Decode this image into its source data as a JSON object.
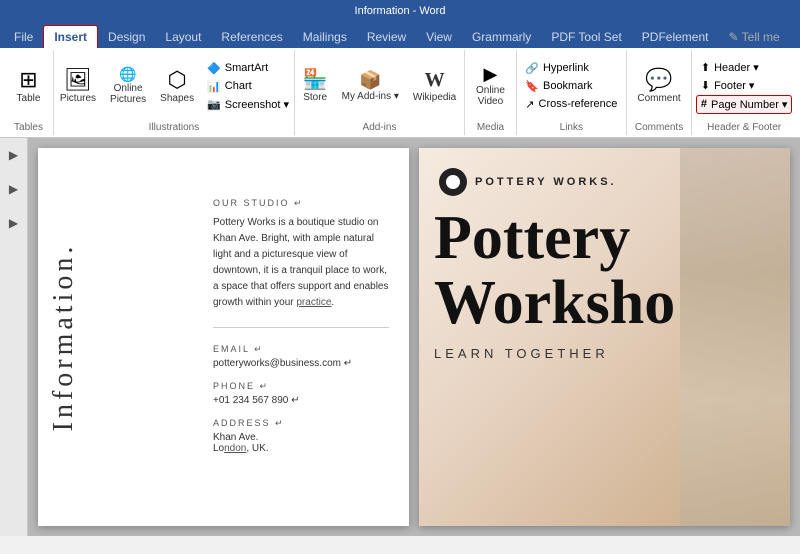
{
  "titlebar": {
    "text": "Information - Word"
  },
  "tabs": [
    {
      "label": "File",
      "active": false
    },
    {
      "label": "Insert",
      "active": true
    },
    {
      "label": "Design",
      "active": false
    },
    {
      "label": "Layout",
      "active": false
    },
    {
      "label": "References",
      "active": false
    },
    {
      "label": "Mailings",
      "active": false
    },
    {
      "label": "Review",
      "active": false
    },
    {
      "label": "View",
      "active": false
    },
    {
      "label": "Grammarly",
      "active": false
    },
    {
      "label": "PDF Tool Set",
      "active": false
    },
    {
      "label": "PDFelement",
      "active": false
    },
    {
      "label": "Tell me",
      "active": false
    }
  ],
  "ribbon": {
    "groups": [
      {
        "id": "tables",
        "label": "Tables",
        "items": [
          {
            "id": "table",
            "icon": "⊞",
            "label": "Table"
          }
        ]
      },
      {
        "id": "illustrations",
        "label": "Illustrations",
        "items": [
          {
            "id": "pictures",
            "icon": "🖼",
            "label": "Pictures"
          },
          {
            "id": "online-pictures",
            "icon": "🌐",
            "label": "Online\nPictures"
          },
          {
            "id": "shapes",
            "icon": "⬡",
            "label": "Shapes"
          },
          {
            "id": "smartart",
            "icon": "🔷",
            "label": "SmartArt"
          },
          {
            "id": "chart",
            "icon": "📊",
            "label": "Chart"
          },
          {
            "id": "screenshot",
            "icon": "📷",
            "label": "Screenshot ▾"
          }
        ]
      },
      {
        "id": "add-ins",
        "label": "Add-ins",
        "items": [
          {
            "id": "store",
            "icon": "🏪",
            "label": "Store"
          },
          {
            "id": "my-add-ins",
            "icon": "📦",
            "label": "My Add-ins ▾"
          },
          {
            "id": "wikipedia",
            "icon": "W",
            "label": "Wikipedia"
          }
        ]
      },
      {
        "id": "media",
        "label": "Media",
        "items": [
          {
            "id": "online-video",
            "icon": "▶",
            "label": "Online\nVideo"
          }
        ]
      },
      {
        "id": "links",
        "label": "Links",
        "items": [
          {
            "id": "hyperlink",
            "icon": "🔗",
            "label": "Hyperlink"
          },
          {
            "id": "bookmark",
            "icon": "🔖",
            "label": "Bookmark"
          },
          {
            "id": "cross-reference",
            "icon": "↗",
            "label": "Cross-reference"
          }
        ]
      },
      {
        "id": "comments",
        "label": "Comments",
        "items": [
          {
            "id": "comment",
            "icon": "💬",
            "label": "Comment"
          }
        ]
      },
      {
        "id": "header-footer",
        "label": "Header & Footer",
        "items": [
          {
            "id": "header",
            "icon": "⬆",
            "label": "Header ▾"
          },
          {
            "id": "footer",
            "icon": "⬇",
            "label": "Footer ▾"
          },
          {
            "id": "page-number",
            "icon": "#",
            "label": "Page Number ▾",
            "highlighted": true
          }
        ]
      }
    ]
  },
  "document": {
    "rotated_title": "Information.",
    "section1": {
      "label": "OUR STUDIO ↵",
      "text": "Pottery Works is a boutique studio on Khan Ave. Bright, with ample natural light and a picturesque view of downtown, it is a tranquil place to work, a space that offers support and enables growth within your practice."
    },
    "section2": {
      "label": "EMAIL ↵",
      "value": "potteryworks@business.com ↵"
    },
    "section3": {
      "label": "PHONE ↵",
      "value": "+01 234 567 890 ↵"
    },
    "section4": {
      "label": "ADDRESS ↵",
      "value1": "Khan Ave.",
      "value2": "London, UK."
    }
  },
  "right_page": {
    "logo_text": "POTTERY WORKS.",
    "title_line1": "Pottery",
    "title_line2": "Worksho",
    "subtitle": "LEARN TOGETHER"
  }
}
